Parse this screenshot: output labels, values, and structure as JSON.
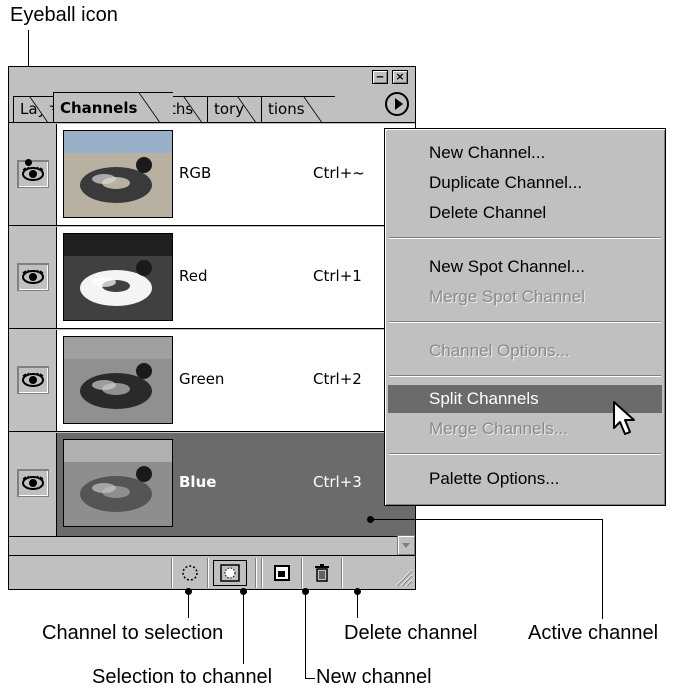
{
  "callouts": {
    "eyeball_icon": "Eyeball icon",
    "channel_to_selection": "Channel to selection",
    "selection_to_channel": "Selection to channel",
    "delete_channel": "Delete channel",
    "new_channel": "New channel",
    "active_channel": "Active channel"
  },
  "palette": {
    "window_buttons": {
      "minimize": "‒",
      "close": "×"
    },
    "tabs": [
      {
        "label": "Laye"
      },
      {
        "label": "Channels"
      },
      {
        "label": "ths"
      },
      {
        "label": "tory"
      },
      {
        "label": "tions"
      }
    ],
    "active_tab": "Channels",
    "channels": [
      {
        "name": "RGB",
        "shortcut": "Ctrl+~",
        "thumb": "color",
        "visible": true,
        "active": false
      },
      {
        "name": "Red",
        "shortcut": "Ctrl+1",
        "thumb": "red",
        "visible": true,
        "active": false
      },
      {
        "name": "Green",
        "shortcut": "Ctrl+2",
        "thumb": "green",
        "visible": true,
        "active": false
      },
      {
        "name": "Blue",
        "shortcut": "Ctrl+3",
        "thumb": "blue",
        "visible": true,
        "active": true
      }
    ],
    "bottom_icons": [
      "channel-to-selection-icon",
      "selection-to-channel-icon",
      "new-channel-icon",
      "trash-icon"
    ]
  },
  "menu": {
    "items": [
      {
        "label": "New Channel...",
        "enabled": true
      },
      {
        "label": "Duplicate Channel...",
        "enabled": true
      },
      {
        "label": "Delete Channel",
        "enabled": true
      },
      {
        "label": "New Spot Channel...",
        "enabled": true
      },
      {
        "label": "Merge Spot Channel",
        "enabled": false
      },
      {
        "label": "Channel Options...",
        "enabled": false
      },
      {
        "label": "Split Channels",
        "enabled": true,
        "highlighted": true
      },
      {
        "label": "Merge Channels...",
        "enabled": false
      },
      {
        "label": "Palette Options...",
        "enabled": true
      }
    ]
  },
  "colors": {
    "face": "#c0c0c0",
    "highlight": "#6b6b6b",
    "disabled_text": "#8a8a8a"
  }
}
